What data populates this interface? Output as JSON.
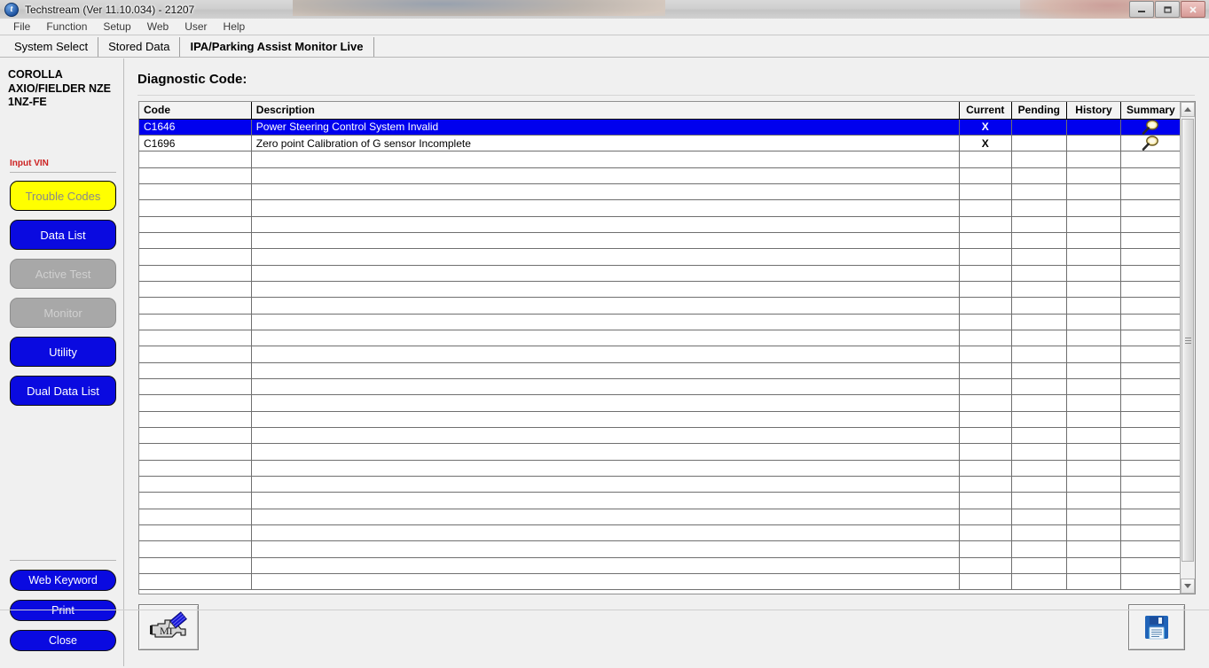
{
  "window": {
    "title": "Techstream (Ver 11.10.034) - 21207",
    "app_icon": "t",
    "minimize_label": "Minimize",
    "restore_label": "Restore",
    "close_label": "Close"
  },
  "menubar": {
    "items": [
      {
        "label": "File"
      },
      {
        "label": "Function"
      },
      {
        "label": "Setup"
      },
      {
        "label": "Web"
      },
      {
        "label": "User"
      },
      {
        "label": "Help"
      }
    ]
  },
  "tabs": [
    {
      "label": "System Select",
      "active": false
    },
    {
      "label": "Stored Data",
      "active": false
    },
    {
      "label": "IPA/Parking Assist Monitor Live",
      "active": true
    }
  ],
  "sidebar": {
    "vehicle": "COROLLA AXIO/FIELDER NZE 1NZ-FE",
    "input_vin_label": "Input VIN",
    "buttons": [
      {
        "label": "Trouble Codes",
        "state": "selected",
        "color": "#ffff00"
      },
      {
        "label": "Data List",
        "state": "enabled",
        "color": "#0a0ae0"
      },
      {
        "label": "Active Test",
        "state": "disabled",
        "color": "#a8a8a8"
      },
      {
        "label": "Monitor",
        "state": "disabled",
        "color": "#a8a8a8"
      },
      {
        "label": "Utility",
        "state": "enabled",
        "color": "#0a0ae0"
      },
      {
        "label": "Dual Data List",
        "state": "enabled",
        "color": "#0a0ae0"
      }
    ],
    "bottom_buttons": [
      {
        "label": "Web Keyword"
      },
      {
        "label": "Print"
      },
      {
        "label": "Close"
      }
    ]
  },
  "main": {
    "heading": "Diagnostic Code:",
    "table": {
      "columns": [
        "Code",
        "Description",
        "Current",
        "Pending",
        "History",
        "Summary"
      ],
      "rows": [
        {
          "code": "C1646",
          "description": "Power Steering Control System Invalid",
          "current": "X",
          "pending": "",
          "history": "",
          "summary": "magnifier-icon",
          "selected": true
        },
        {
          "code": "C1696",
          "description": "Zero point Calibration of G sensor Incomplete",
          "current": "X",
          "pending": "",
          "history": "",
          "summary": "magnifier-icon",
          "selected": false
        }
      ],
      "empty_row_count": 27
    },
    "toolbar": {
      "mil_button": "mil-engine-icon",
      "save_button": "save-floppy-icon"
    }
  },
  "colors": {
    "selection": "#0000ee",
    "button_blue": "#0a0ae0",
    "button_yellow": "#ffff00",
    "button_disabled": "#a8a8a8",
    "vin_red": "#cc2222"
  }
}
